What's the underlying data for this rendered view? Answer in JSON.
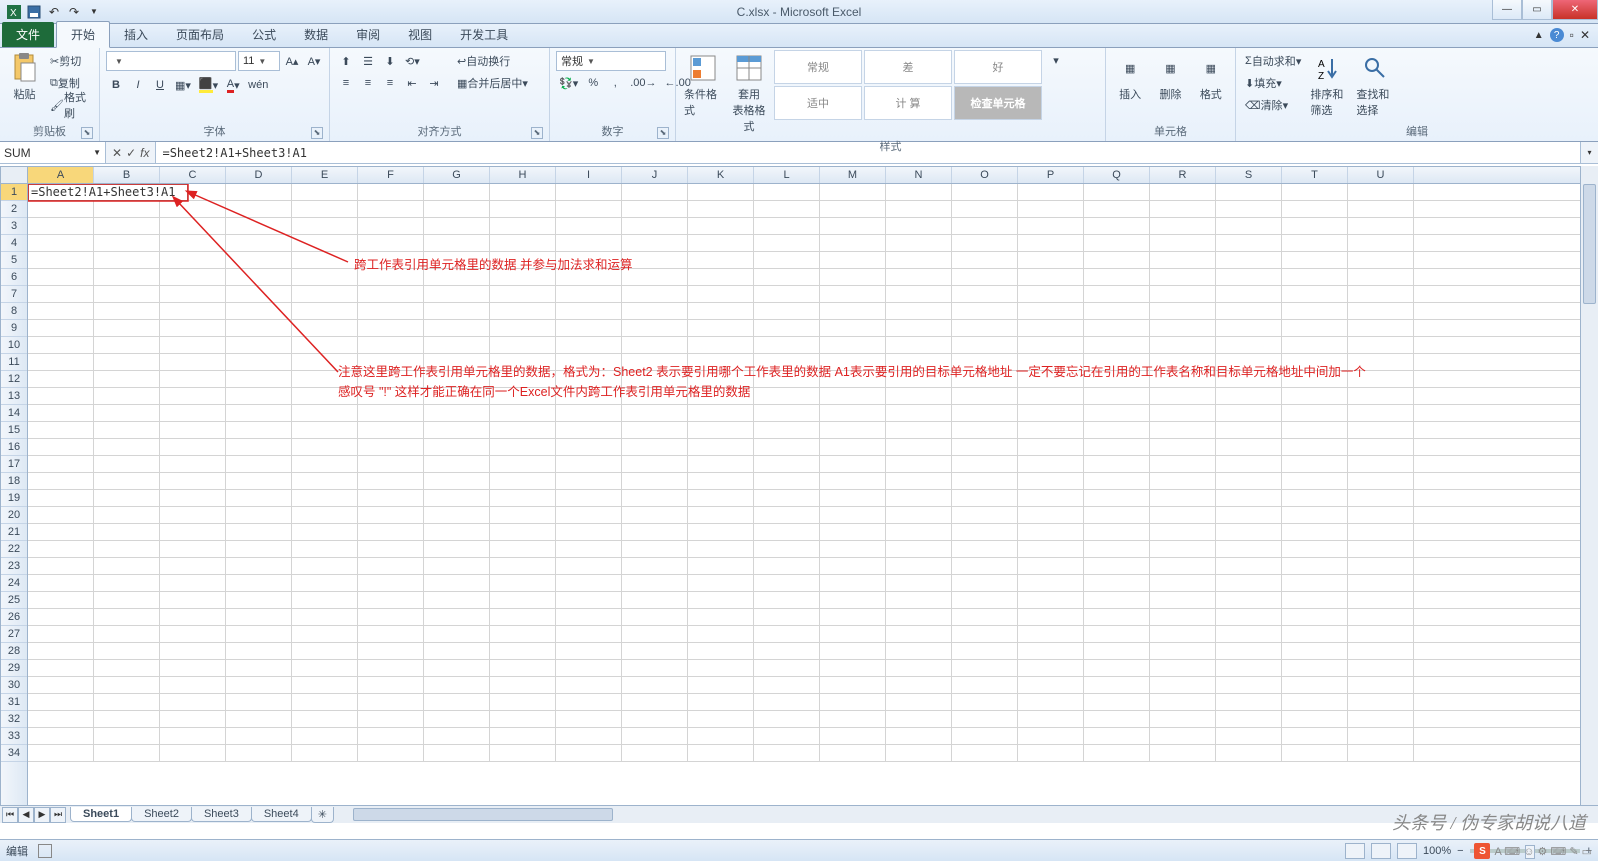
{
  "title": "C.xlsx - Microsoft Excel",
  "ribbon": {
    "file": "文件",
    "tabs": [
      "开始",
      "插入",
      "页面布局",
      "公式",
      "数据",
      "审阅",
      "视图",
      "开发工具"
    ],
    "active_tab": 0,
    "clipboard": {
      "paste": "粘贴",
      "cut": "剪切",
      "copy": "复制",
      "painter": "格式刷",
      "label": "剪贴板"
    },
    "font": {
      "size": "11",
      "label": "字体",
      "bold": "B",
      "italic": "I",
      "underline": "U"
    },
    "align": {
      "wrap": "自动换行",
      "merge": "合并后居中",
      "label": "对齐方式"
    },
    "number": {
      "format": "常规",
      "label": "数字"
    },
    "styles": {
      "cond": "条件格式",
      "table": "套用\n表格格式",
      "gallery": [
        [
          "常规",
          "差",
          "好"
        ],
        [
          "适中",
          "计 算",
          "检查单元格"
        ]
      ],
      "label": "样式"
    },
    "cells": {
      "insert": "插入",
      "delete": "删除",
      "format": "格式",
      "label": "单元格"
    },
    "editing": {
      "sum": "自动求和",
      "fill": "填充",
      "clear": "清除",
      "sort": "排序和筛选",
      "find": "查找和选择",
      "label": "编辑"
    }
  },
  "namebox": "SUM",
  "formula": "=Sheet2!A1+Sheet3!A1",
  "cell_edit": "=Sheet2!A1+Sheet3!A1",
  "columns": [
    "A",
    "B",
    "C",
    "D",
    "E",
    "F",
    "G",
    "H",
    "I",
    "J",
    "K",
    "L",
    "M",
    "N",
    "O",
    "P",
    "Q",
    "R",
    "S",
    "T",
    "U"
  ],
  "row_count": 34,
  "active_col": 0,
  "active_row": 1,
  "sheets": [
    "Sheet1",
    "Sheet2",
    "Sheet3",
    "Sheet4"
  ],
  "active_sheet": 0,
  "status": {
    "mode": "编辑",
    "zoom": "100%"
  },
  "annotations": {
    "a1": "跨工作表引用单元格里的数据 并参与加法求和运算",
    "a2": "注意这里跨工作表引用单元格里的数据，格式为：Sheet2 表示要引用哪个工作表里的数据  A1表示要引用的目标单元格地址 一定不要忘记在引用的工作表名称和目标单元格地址中间加一个感叹号 \"!\" 这样才能正确在同一个Excel文件内跨工作表引用单元格里的数据"
  },
  "watermark": "头条号 / 伪专家胡说八道"
}
